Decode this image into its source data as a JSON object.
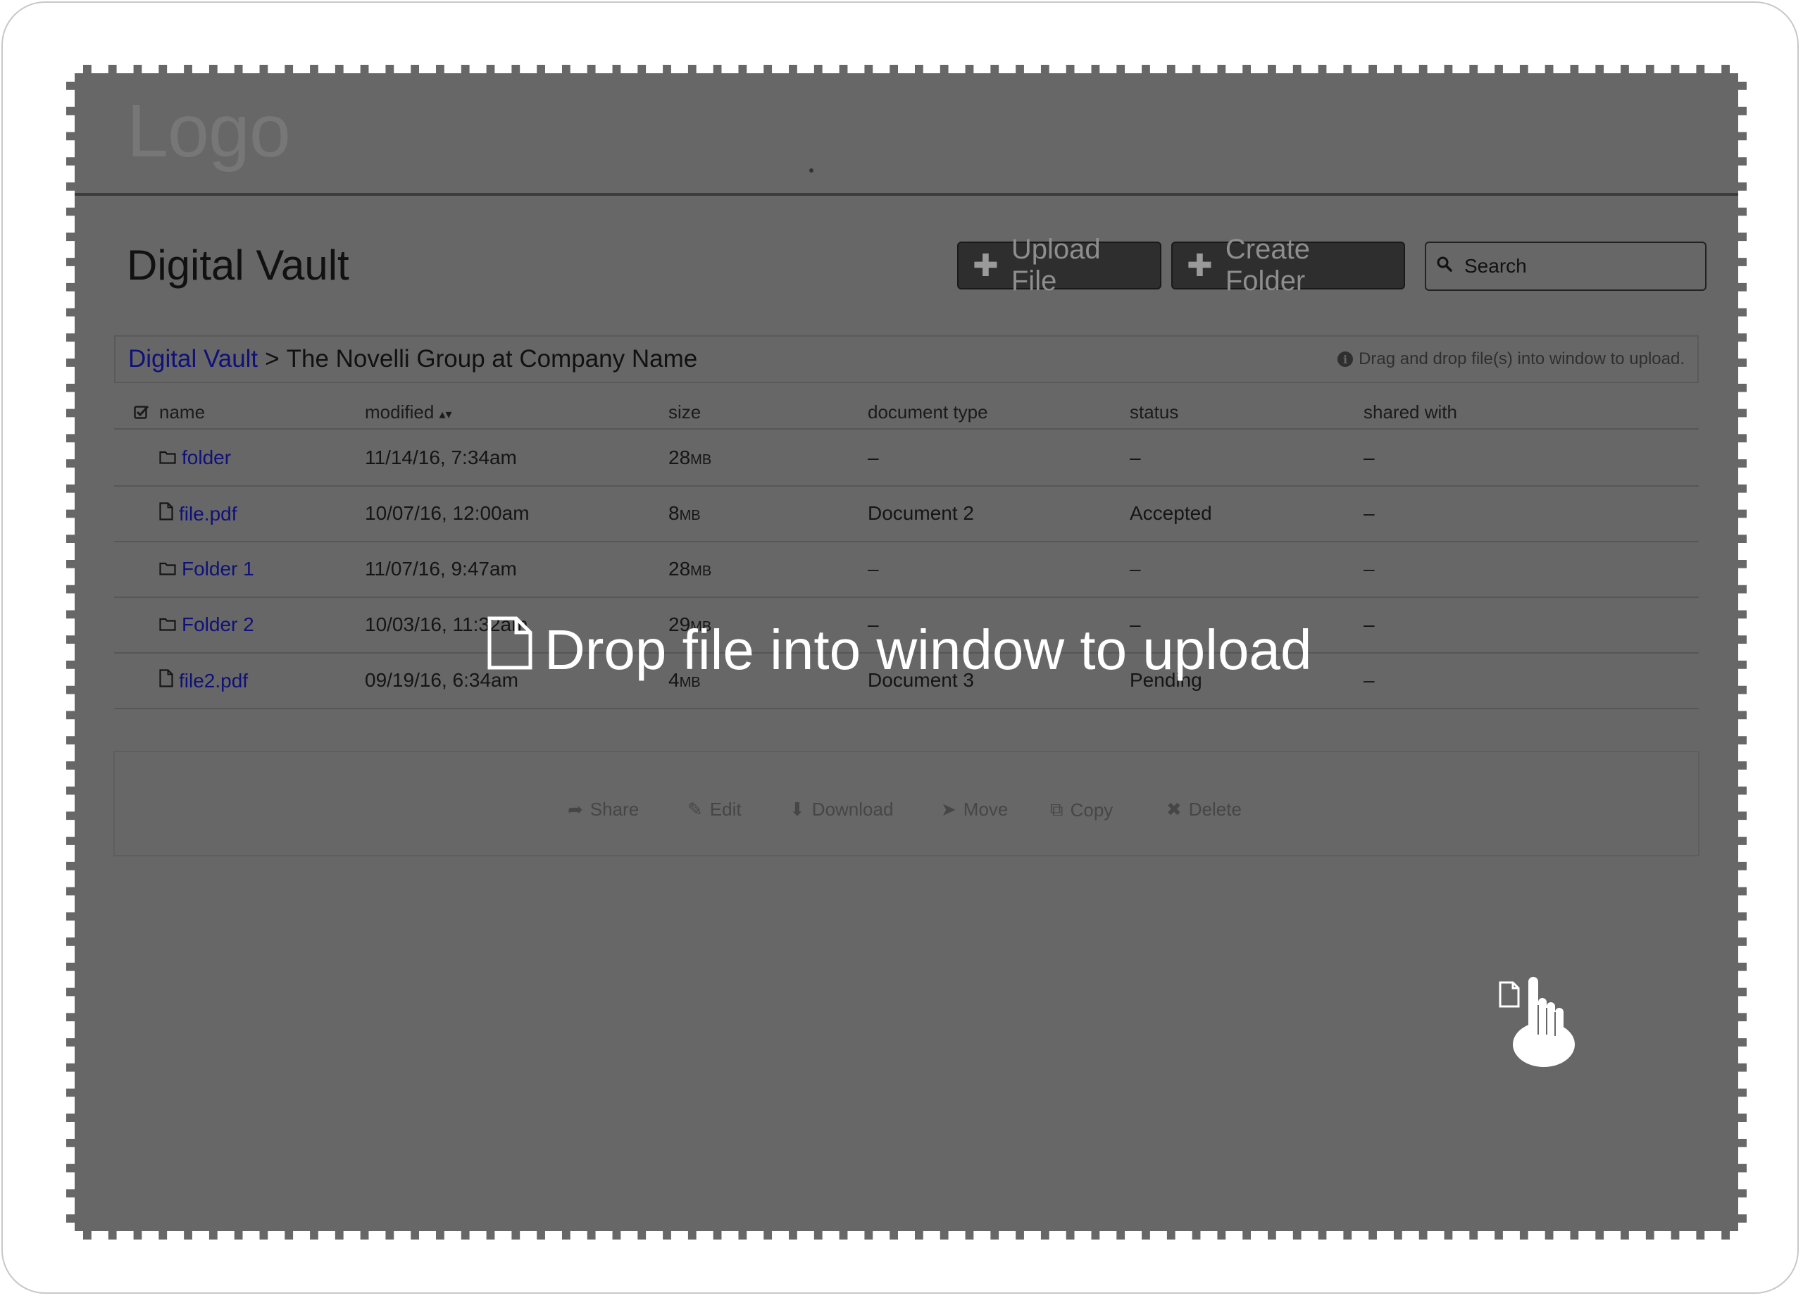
{
  "header": {
    "logo_text": "Logo"
  },
  "page": {
    "title": "Digital Vault",
    "upload_button": "Upload File",
    "create_folder_button": "Create Folder",
    "search_placeholder": "Search"
  },
  "breadcrumb": {
    "root": "Digital Vault",
    "separator": ">",
    "current": "The Novelli Group at Company Name",
    "hint": "Drag and drop file(s) into window to upload."
  },
  "table": {
    "columns": {
      "name": "name",
      "modified": "modified",
      "size": "size",
      "document_type": "document type",
      "status": "status",
      "shared_with": "shared with"
    },
    "rows": [
      {
        "icon": "folder-icon",
        "name": "folder",
        "modified": "11/14/16, 7:34am",
        "size": "28",
        "unit": "MB",
        "document_type": "–",
        "status": "–",
        "shared_with": "–"
      },
      {
        "icon": "file-icon",
        "name": "file.pdf",
        "modified": "10/07/16, 12:00am",
        "size": "8",
        "unit": "MB",
        "document_type": "Document 2",
        "status": "Accepted",
        "shared_with": "–"
      },
      {
        "icon": "folder-icon",
        "name": "Folder 1",
        "modified": "11/07/16, 9:47am",
        "size": "28",
        "unit": "MB",
        "document_type": "–",
        "status": "–",
        "shared_with": "–"
      },
      {
        "icon": "folder-icon",
        "name": "Folder 2",
        "modified": "10/03/16, 11:32am",
        "size": "29",
        "unit": "MB",
        "document_type": "–",
        "status": "–",
        "shared_with": "–"
      },
      {
        "icon": "file-icon",
        "name": "file2.pdf",
        "modified": "09/19/16, 6:34am",
        "size": "4",
        "unit": "MB",
        "document_type": "Document 3",
        "status": "Pending",
        "shared_with": "–"
      }
    ]
  },
  "actions": {
    "share": "Share",
    "edit": "Edit",
    "download": "Download",
    "move": "Move",
    "copy": "Copy",
    "delete": "Delete"
  },
  "overlay": {
    "drop_message": "Drop file into window to upload"
  }
}
